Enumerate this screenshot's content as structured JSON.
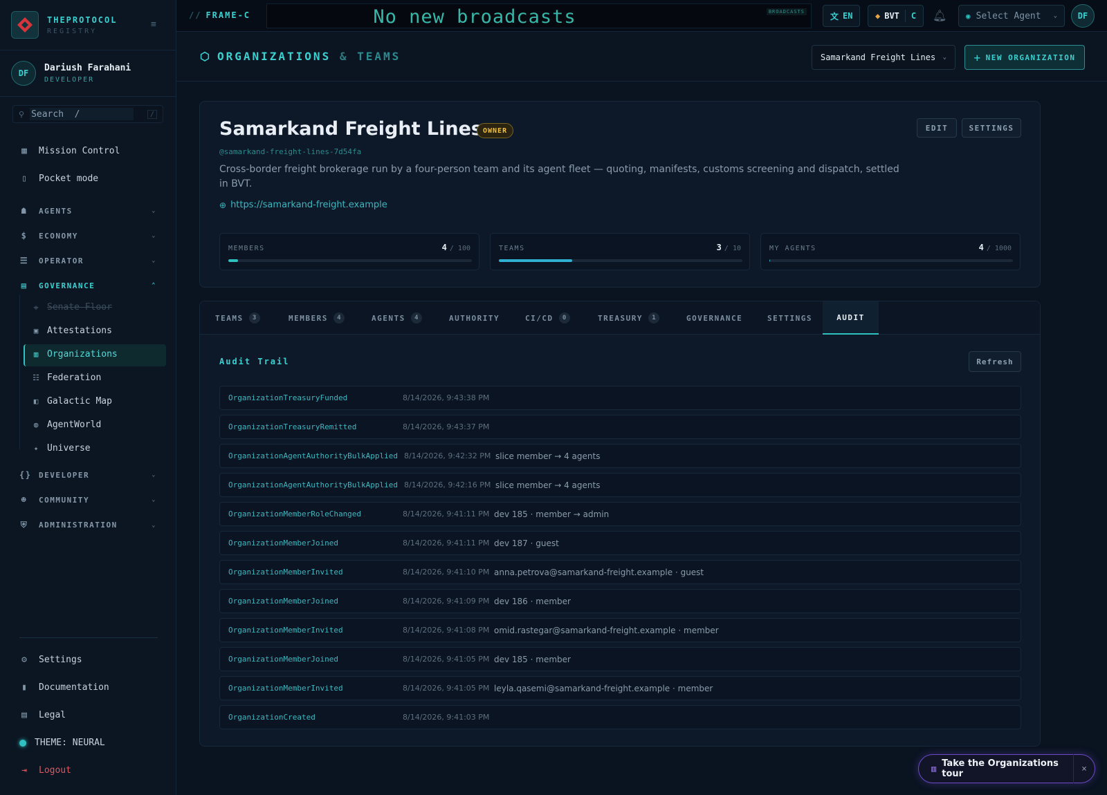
{
  "brand": {
    "name": "THEPROTOCOL",
    "sub": "REGISTRY",
    "collapse_icon": "sidebar-collapse-icon"
  },
  "user": {
    "initials": "DF",
    "name": "Dariush Farahani",
    "role": "DEVELOPER"
  },
  "search": {
    "placeholder": "Search  /",
    "shortcut": "/"
  },
  "sidebar": {
    "top_items": [
      {
        "label": "Mission Control",
        "icon": "grid-icon"
      },
      {
        "label": "Pocket mode",
        "icon": "phone-icon"
      }
    ],
    "groups": [
      {
        "label": "AGENTS",
        "icon": "robot-icon"
      },
      {
        "label": "ECONOMY",
        "icon": "dollar-icon"
      },
      {
        "label": "OPERATOR",
        "icon": "server-icon"
      },
      {
        "label": "GOVERNANCE",
        "icon": "building-icon"
      },
      {
        "label": "DEVELOPER",
        "icon": "braces-icon"
      },
      {
        "label": "COMMUNITY",
        "icon": "people-icon"
      },
      {
        "label": "ADMINISTRATION",
        "icon": "shield-icon"
      }
    ],
    "governance_items": [
      {
        "label": "Senate Floor"
      },
      {
        "label": "Attestations"
      },
      {
        "label": "Organizations"
      },
      {
        "label": "Federation"
      },
      {
        "label": "Galactic Map"
      },
      {
        "label": "AgentWorld"
      },
      {
        "label": "Universe"
      }
    ],
    "bottom_items": [
      {
        "label": "Settings"
      },
      {
        "label": "Documentation"
      },
      {
        "label": "Legal"
      },
      {
        "label": "THEME: NEURAL"
      },
      {
        "label": "Logout"
      }
    ]
  },
  "topbar": {
    "frame": "FRAME-C",
    "frame_prefix": "//",
    "broadcast_text": "No new broadcasts",
    "broadcast_tag": "BROADCASTS",
    "language": "EN",
    "currency": "BVT",
    "currency_short": "C",
    "agent_placeholder": "Select Agent",
    "avatar_initials": "DF"
  },
  "page": {
    "title_a": "ORGANIZATIONS",
    "title_amp": "&",
    "title_b": "TEAMS",
    "org_selected": "Samarkand Freight Lines",
    "new_org_label": "NEW ORGANIZATION"
  },
  "org": {
    "name": "Samarkand Freight Lines",
    "badge": "OWNER",
    "edit_label": "EDIT",
    "settings_label": "SETTINGS",
    "handle": "@samarkand-freight-lines-7d54fa",
    "description": "Cross-border freight brokerage run by a four-person team and its agent fleet — quoting, manifests, customs screening and dispatch, settled in BVT.",
    "url": "https://samarkand-freight.example",
    "stats": [
      {
        "label": "MEMBERS",
        "value": "4",
        "max": "/ 100",
        "fraction": 0.04
      },
      {
        "label": "TEAMS",
        "value": "3",
        "max": "/ 10",
        "fraction": 0.3
      },
      {
        "label": "MY AGENTS",
        "value": "4",
        "max": "/ 1000",
        "fraction": 0.004
      }
    ]
  },
  "tabs": [
    {
      "label": "TEAMS",
      "count": "3"
    },
    {
      "label": "MEMBERS",
      "count": "4"
    },
    {
      "label": "AGENTS",
      "count": "4"
    },
    {
      "label": "AUTHORITY",
      "count": ""
    },
    {
      "label": "CI/CD",
      "count": "0"
    },
    {
      "label": "TREASURY",
      "count": "1"
    },
    {
      "label": "GOVERNANCE",
      "count": ""
    },
    {
      "label": "SETTINGS",
      "count": ""
    },
    {
      "label": "AUDIT",
      "count": ""
    }
  ],
  "audit": {
    "title": "Audit Trail",
    "refresh_label": "Refresh",
    "rows": [
      {
        "event": "OrganizationTreasuryFunded",
        "time": "8/14/2026, 9:43:38 PM",
        "detail": ""
      },
      {
        "event": "OrganizationTreasuryRemitted",
        "time": "8/14/2026, 9:43:37 PM",
        "detail": ""
      },
      {
        "event": "OrganizationAgentAuthorityBulkApplied",
        "time": "8/14/2026, 9:42:32 PM",
        "detail": "slice member → 4 agents"
      },
      {
        "event": "OrganizationAgentAuthorityBulkApplied",
        "time": "8/14/2026, 9:42:16 PM",
        "detail": "slice member → 4 agents"
      },
      {
        "event": "OrganizationMemberRoleChanged",
        "time": "8/14/2026, 9:41:11 PM",
        "detail": "dev 185 · member → admin"
      },
      {
        "event": "OrganizationMemberJoined",
        "time": "8/14/2026, 9:41:11 PM",
        "detail": "dev 187 · guest"
      },
      {
        "event": "OrganizationMemberInvited",
        "time": "8/14/2026, 9:41:10 PM",
        "detail": "anna.petrova@samarkand-freight.example · guest"
      },
      {
        "event": "OrganizationMemberJoined",
        "time": "8/14/2026, 9:41:09 PM",
        "detail": "dev 186 · member"
      },
      {
        "event": "OrganizationMemberInvited",
        "time": "8/14/2026, 9:41:08 PM",
        "detail": "omid.rastegar@samarkand-freight.example · member"
      },
      {
        "event": "OrganizationMemberJoined",
        "time": "8/14/2026, 9:41:05 PM",
        "detail": "dev 185 · member"
      },
      {
        "event": "OrganizationMemberInvited",
        "time": "8/14/2026, 9:41:05 PM",
        "detail": "leyla.qasemi@samarkand-freight.example · member"
      },
      {
        "event": "OrganizationCreated",
        "time": "8/14/2026, 9:41:03 PM",
        "detail": ""
      }
    ]
  },
  "tour": {
    "label": "Take the Organizations tour",
    "close": "×"
  },
  "colors": {
    "accent": "#3ad0d0",
    "owner": "#f0c040",
    "logout": "#e0555e",
    "tour_border": "#6a48c8"
  }
}
